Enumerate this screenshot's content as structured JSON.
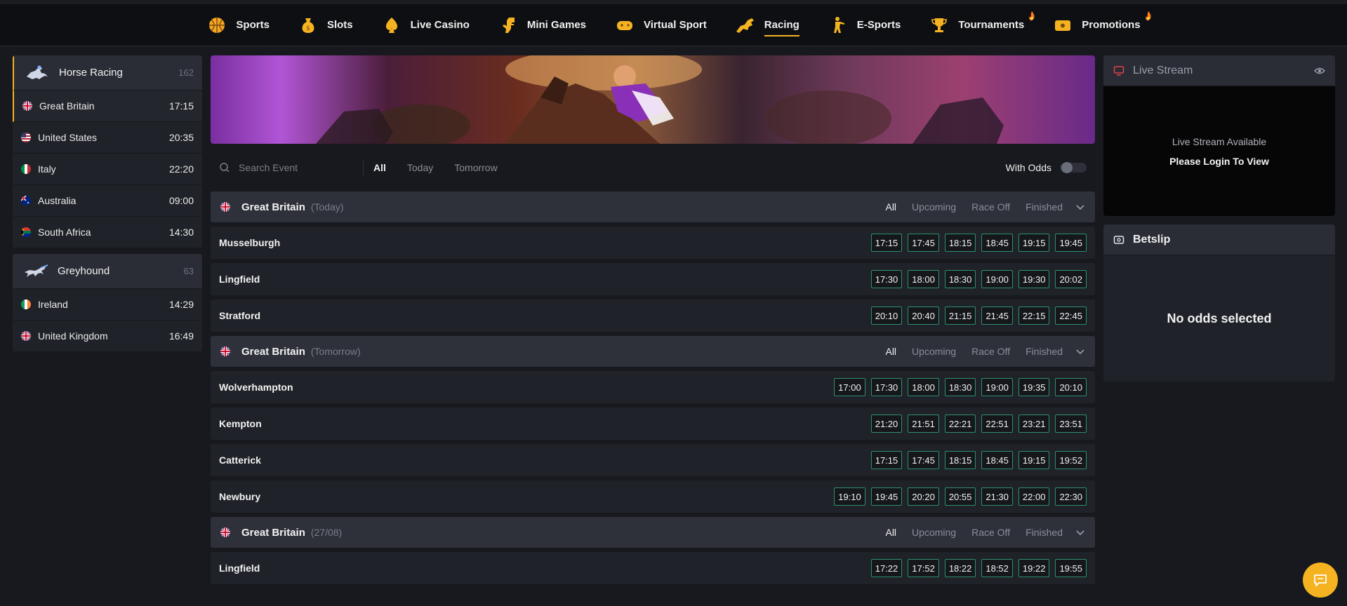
{
  "nav": [
    {
      "label": "Sports",
      "icon": "basketball-icon",
      "hot": false,
      "active": false
    },
    {
      "label": "Slots",
      "icon": "money-bag-icon",
      "hot": false,
      "active": false
    },
    {
      "label": "Live Casino",
      "icon": "spade-icon",
      "hot": false,
      "active": false
    },
    {
      "label": "Mini Games",
      "icon": "dinosaur-icon",
      "hot": false,
      "active": false
    },
    {
      "label": "Virtual Sport",
      "icon": "gamepad-icon",
      "hot": false,
      "active": false
    },
    {
      "label": "Racing",
      "icon": "horse-icon",
      "hot": false,
      "active": true
    },
    {
      "label": "E-Sports",
      "icon": "soldier-icon",
      "hot": false,
      "active": false
    },
    {
      "label": "Tournaments",
      "icon": "trophy-icon",
      "hot": true,
      "active": false
    },
    {
      "label": "Promotions",
      "icon": "ticket-icon",
      "hot": true,
      "active": false
    }
  ],
  "sidebar": {
    "horse": {
      "label": "Horse Racing",
      "count": "162",
      "items": [
        {
          "name": "Great Britain",
          "time": "17:15",
          "flag": "gb",
          "active": true
        },
        {
          "name": "United States",
          "time": "20:35",
          "flag": "us",
          "active": false
        },
        {
          "name": "Italy",
          "time": "22:20",
          "flag": "it",
          "active": false
        },
        {
          "name": "Australia",
          "time": "09:00",
          "flag": "au",
          "active": false
        },
        {
          "name": "South Africa",
          "time": "14:30",
          "flag": "za",
          "active": false
        }
      ]
    },
    "greyhound": {
      "label": "Greyhound",
      "count": "63",
      "items": [
        {
          "name": "Ireland",
          "time": "14:29",
          "flag": "ie",
          "active": false
        },
        {
          "name": "United Kingdom",
          "time": "16:49",
          "flag": "gb",
          "active": false
        }
      ]
    }
  },
  "filter": {
    "search_placeholder": "Search Event",
    "tabs": [
      "All",
      "Today",
      "Tomorrow"
    ],
    "with_odds": "With Odds"
  },
  "sections": [
    {
      "title": "Great Britain",
      "sub": "(Today)",
      "tabs": [
        "All",
        "Upcoming",
        "Race Off",
        "Finished"
      ],
      "events": [
        {
          "name": "Musselburgh",
          "times": [
            "17:15",
            "17:45",
            "18:15",
            "18:45",
            "19:15",
            "19:45"
          ]
        },
        {
          "name": "Lingfield",
          "times": [
            "17:30",
            "18:00",
            "18:30",
            "19:00",
            "19:30",
            "20:02"
          ]
        },
        {
          "name": "Stratford",
          "times": [
            "20:10",
            "20:40",
            "21:15",
            "21:45",
            "22:15",
            "22:45"
          ]
        }
      ]
    },
    {
      "title": "Great Britain",
      "sub": "(Tomorrow)",
      "tabs": [
        "All",
        "Upcoming",
        "Race Off",
        "Finished"
      ],
      "events": [
        {
          "name": "Wolverhampton",
          "times": [
            "17:00",
            "17:30",
            "18:00",
            "18:30",
            "19:00",
            "19:35",
            "20:10"
          ]
        },
        {
          "name": "Kempton",
          "times": [
            "21:20",
            "21:51",
            "22:21",
            "22:51",
            "23:21",
            "23:51"
          ]
        },
        {
          "name": "Catterick",
          "times": [
            "17:15",
            "17:45",
            "18:15",
            "18:45",
            "19:15",
            "19:52"
          ]
        },
        {
          "name": "Newbury",
          "times": [
            "19:10",
            "19:45",
            "20:20",
            "20:55",
            "21:30",
            "22:00",
            "22:30"
          ]
        }
      ]
    },
    {
      "title": "Great Britain",
      "sub": "(27/08)",
      "tabs": [
        "All",
        "Upcoming",
        "Race Off",
        "Finished"
      ],
      "events": [
        {
          "name": "Lingfield",
          "times": [
            "17:22",
            "17:52",
            "18:22",
            "18:52",
            "19:22",
            "19:55"
          ]
        }
      ]
    }
  ],
  "live_stream": {
    "title": "Live Stream",
    "line1": "Live Stream Available",
    "line2": "Please Login To View"
  },
  "betslip": {
    "title": "Betslip",
    "empty": "No odds selected"
  },
  "colors": {
    "accent": "#f5b322",
    "odds_border": "#2f8f6f",
    "bg": "#17191e"
  }
}
